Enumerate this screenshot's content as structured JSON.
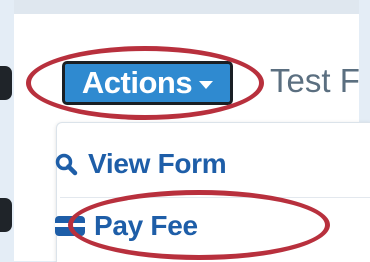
{
  "header": {
    "actions_label": "Actions",
    "next_text": "Test F"
  },
  "menu": {
    "items": [
      {
        "label": "View Form",
        "icon": "search-icon"
      },
      {
        "label": "Pay Fee",
        "icon": "credit-card-icon"
      }
    ]
  },
  "colors": {
    "button_blue": "#2f8ad0",
    "menu_text_blue": "#1e5ea8",
    "highlight_red": "#b8303d",
    "page_background": "#e4edf6"
  }
}
